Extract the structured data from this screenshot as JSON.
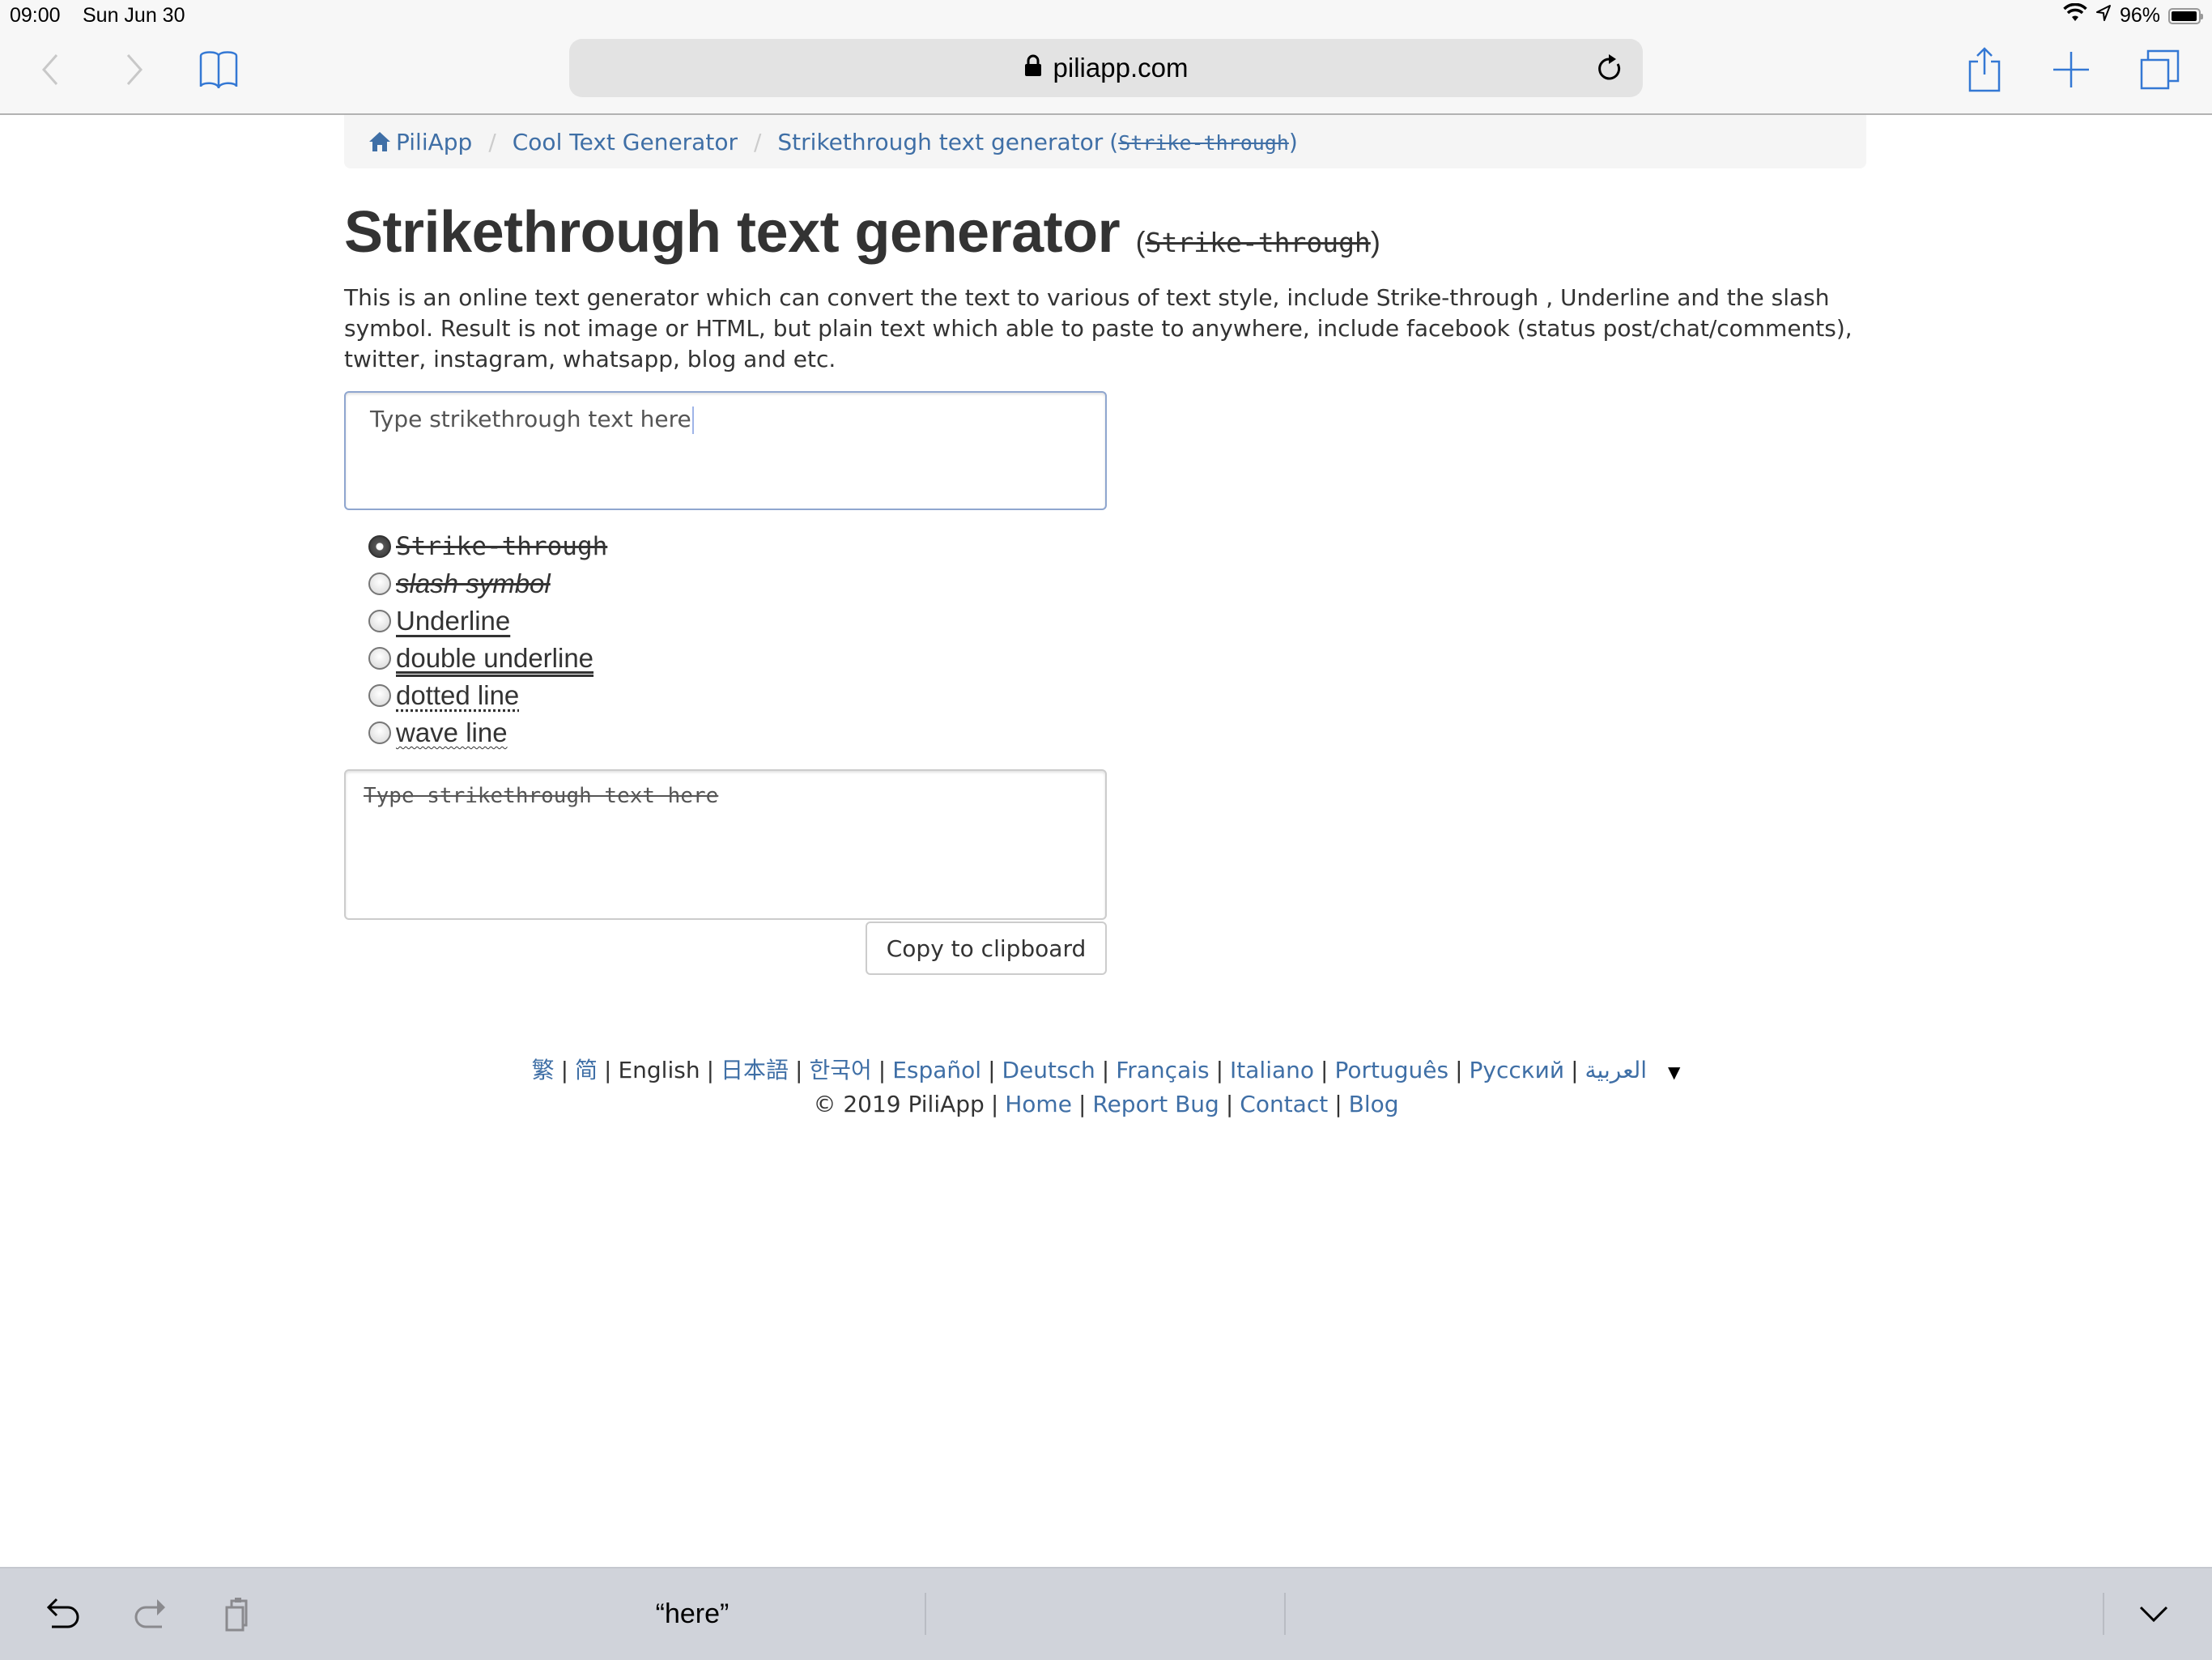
{
  "status_bar": {
    "time": "09:00",
    "date": "Sun Jun 30",
    "battery_text": "96%",
    "battery_level": 0.96
  },
  "browser": {
    "url": "piliapp.com",
    "icons": {
      "back": "chevron-left-icon",
      "forward": "chevron-right-icon",
      "bookmarks": "book-icon",
      "lock": "lock-icon",
      "reload": "reload-icon",
      "share": "share-icon",
      "new_tab": "plus-icon",
      "tabs": "tabs-icon"
    },
    "accent_color": "#3478d4"
  },
  "breadcrumb": {
    "items": [
      {
        "label": "PiliApp",
        "icon": "home-icon"
      },
      {
        "label": "Cool Text Generator"
      },
      {
        "label": "Strikethrough text generator",
        "styled_suffix": "(-S-t-r-i-k-e---t-h-r-o-u-g-h)"
      }
    ],
    "separator": "/"
  },
  "page": {
    "title": "Strikethrough text generator",
    "title_suffix": "Strike-through",
    "description": "This is an online text generator which can convert the text to various of text style, include Strike-through , Underline and the slash symbol. Result is not image or HTML, but plain text which able to paste to anywhere, include facebook (status post/chat/comments), twitter, instagram, whatsapp, blog and etc.",
    "link_color": "#3f6fa6"
  },
  "input": {
    "value": "Type strikethrough text here"
  },
  "styles": {
    "selected": "strike-through",
    "options": [
      {
        "id": "strike-through",
        "label": "Strike-through",
        "checked": true
      },
      {
        "id": "slash",
        "label": "slash symbol",
        "checked": false
      },
      {
        "id": "underline",
        "label": "Underline",
        "checked": false
      },
      {
        "id": "double-underline",
        "label": "double underline",
        "checked": false
      },
      {
        "id": "dotted",
        "label": "dotted line",
        "checked": false
      },
      {
        "id": "wave",
        "label": "wave line",
        "checked": false
      }
    ]
  },
  "output": {
    "value": "Type strikethrough text here"
  },
  "copy_button": {
    "label": "Copy to clipboard"
  },
  "footer": {
    "languages": [
      {
        "label": "繁",
        "link": true
      },
      {
        "label": "简",
        "link": true
      },
      {
        "label": "English",
        "link": false
      },
      {
        "label": "日本語",
        "link": true
      },
      {
        "label": "한국어",
        "link": true
      },
      {
        "label": "Español",
        "link": true
      },
      {
        "label": "Deutsch",
        "link": true
      },
      {
        "label": "Français",
        "link": true
      },
      {
        "label": "Italiano",
        "link": true
      },
      {
        "label": "Português",
        "link": true
      },
      {
        "label": "Русский",
        "link": true
      },
      {
        "label": "العربية",
        "link": true
      }
    ],
    "more_symbol": "▼",
    "copyright": "© 2019 PiliApp",
    "links": [
      "Home",
      "Report Bug",
      "Contact",
      "Blog"
    ]
  },
  "keyboard_bar": {
    "suggestion": "“here”",
    "icons": {
      "undo": "undo-icon",
      "redo": "redo-icon",
      "paste": "paste-icon",
      "dismiss": "chevron-down-icon"
    }
  }
}
